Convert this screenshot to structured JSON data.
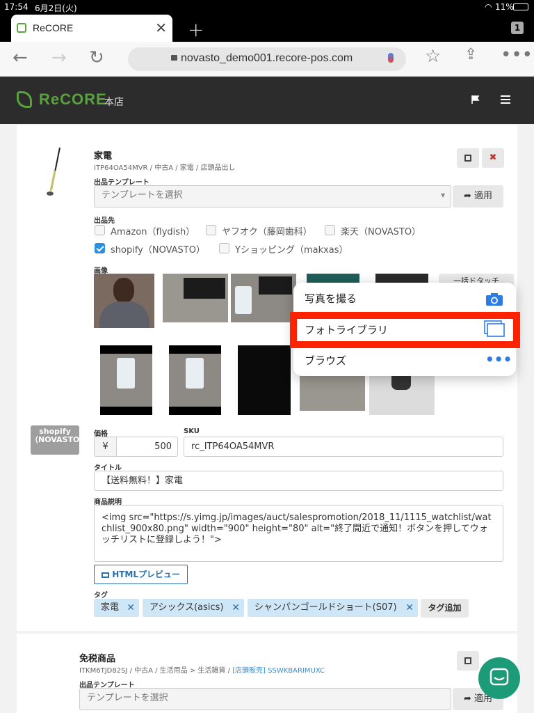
{
  "status": {
    "time": "17:54",
    "date": "6月2日(火)",
    "battery": "11%"
  },
  "browser": {
    "tab_title": "ReCORE",
    "tab_count": "1",
    "url": "novasto_demo001.recore-pos.com"
  },
  "app": {
    "brand": "ReCORE",
    "store": "本店"
  },
  "product1": {
    "name": "家電",
    "meta": "ITP64OA54MVR / 中古A / 家電 / 店頭品出し",
    "template_label": "出品テンプレート",
    "template_placeholder": "テンプレートを選択",
    "apply_label": "適用",
    "channels_label": "出品先",
    "channels": [
      {
        "label": "Amazon（flydish）",
        "checked": false
      },
      {
        "label": "ヤフオク（藤岡歯科）",
        "checked": false
      },
      {
        "label": "楽天（NOVASTO）",
        "checked": false
      },
      {
        "label": "shopify（NOVASTO）",
        "checked": true
      },
      {
        "label": "Yショッピング（makxas）",
        "checked": false
      }
    ],
    "images_label": "画像",
    "bulk_button": "一括ドタッチ",
    "shopify_badge": "shopify（NOVASTO）",
    "price_label": "価格",
    "currency": "¥",
    "price": "500",
    "sku_label": "SKU",
    "sku": "rc_ITP64OA54MVR",
    "title_label": "タイトル",
    "title_value": "【送料無料！】家電",
    "desc_label": "商品説明",
    "desc_value": "<img src=\"https://s.yimg.jp/images/auct/salespromotion/2018_11/1115_watchlist/watchlist_900x80.png\" width=\"900\" height=\"80\" alt=\"終了間近で通知！ボタンを押してウォッチリストに登録しよう！\">",
    "html_preview": "HTMLプレビュー",
    "tags_label": "タグ",
    "tags": [
      "家電",
      "アシックス(asics)",
      "シャンパンゴールドショート(S07)"
    ],
    "add_tag": "タグ追加"
  },
  "product2": {
    "name": "免税商品",
    "meta": "ITKM6TJD82SJ / 中古A / 生活用品 > 生活雑貨 /",
    "meta_link": "[店頭販売] SSWKBARIMUXC",
    "template_label": "出品テンプレート",
    "template_placeholder": "テンプレートを選択",
    "apply_label": "適用"
  },
  "popover": {
    "take_photo": "写真を撮る",
    "photo_library": "フォトライブラリ",
    "browse": "ブラウズ"
  },
  "colors": {
    "accent": "#5aa23b",
    "highlight": "#ff2200",
    "link": "#2d8fdd"
  }
}
